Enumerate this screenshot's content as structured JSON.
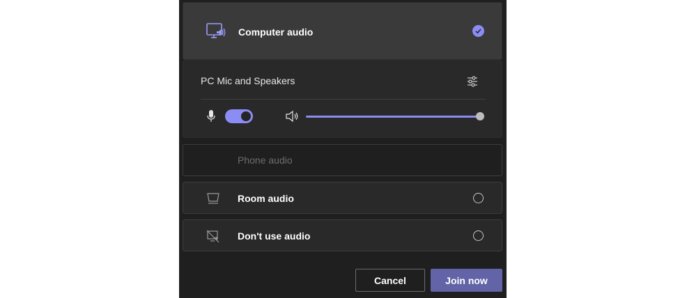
{
  "audio_options": {
    "computer_audio": {
      "label": "Computer audio",
      "icon": "computer-audio-icon",
      "selected": true
    },
    "phone_audio": {
      "label": "Phone audio",
      "disabled": true
    },
    "room_audio": {
      "label": "Room audio",
      "icon": "room-audio-icon",
      "selected": false
    },
    "no_audio": {
      "label": "Don't use audio",
      "icon": "no-audio-icon",
      "selected": false
    }
  },
  "device": {
    "label": "PC Mic and Speakers",
    "mic_enabled": true,
    "speaker_volume": 1.0
  },
  "buttons": {
    "cancel": "Cancel",
    "join": "Join now"
  },
  "colors": {
    "accent": "#8b8cf4",
    "primary_button": "#6264a7",
    "background": "#1f1f1f"
  }
}
